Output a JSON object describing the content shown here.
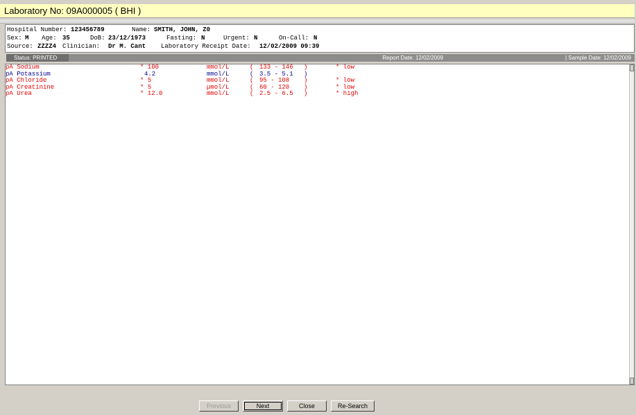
{
  "window": {
    "title": "Laboratory No: 09A000005  ( BHI )"
  },
  "patient": {
    "hospital_number_label": "Hospital Number:",
    "hospital_number": "123456789",
    "name_label": "Name:",
    "name": "SMITH, JOHN, Z0",
    "sex_label": "Sex:",
    "sex": "M",
    "age_label": "Age:",
    "age": "35",
    "dob_label": "DoB:",
    "dob": "23/12/1973",
    "fasting_label": "Fasting:",
    "fasting": "N",
    "urgent_label": "Urgent:",
    "urgent": "N",
    "oncall_label": "On-Call:",
    "oncall": "N",
    "source_label": "Source:",
    "source": "ZZZZ4",
    "clinician_label": "Clinician:",
    "clinician": "Dr M. Cant",
    "receipt_label": "Laboratory Receipt Date:",
    "receipt_date": "12/02/2009 09:39"
  },
  "status": {
    "status_text": "Status: PRINTED",
    "report_date": "Report Date: 12/02/2009",
    "sample_date": "| Sample Date: 12/02/2009"
  },
  "results": [
    {
      "test": "pA Sodium",
      "value": "* 100",
      "unit": "mmol/L",
      "range_open": "(",
      "range": "133 - 146",
      "range_close": ")",
      "flag": "* low",
      "status": "abnormal"
    },
    {
      "test": "pA Potassium",
      "value": "4.2",
      "unit": "mmol/L",
      "range_open": "(",
      "range": "3.5 - 5.1",
      "range_close": ")",
      "flag": "",
      "status": "normal"
    },
    {
      "test": "pA Chloride",
      "value": "* 5",
      "unit": "mmol/L",
      "range_open": "(",
      "range": "95 - 108",
      "range_close": ")",
      "flag": "* low",
      "status": "abnormal"
    },
    {
      "test": "pA Creatinine",
      "value": "* 5",
      "unit": "µmol/L",
      "range_open": "(",
      "range": "60 - 120",
      "range_close": ")",
      "flag": "* low",
      "status": "abnormal"
    },
    {
      "test": "pA Urea",
      "value": "* 12.0",
      "unit": "mmol/L",
      "range_open": "(",
      "range": "2.5 - 6.5",
      "range_close": ")",
      "flag": "* high",
      "status": "abnormal"
    }
  ],
  "colors": {
    "abnormal": "#e00000",
    "normal": "#000090",
    "title_bg": "#ffffc0"
  },
  "buttons": {
    "previous": "Previous",
    "next": "Next",
    "close": "Close",
    "research": "Re-Search"
  }
}
